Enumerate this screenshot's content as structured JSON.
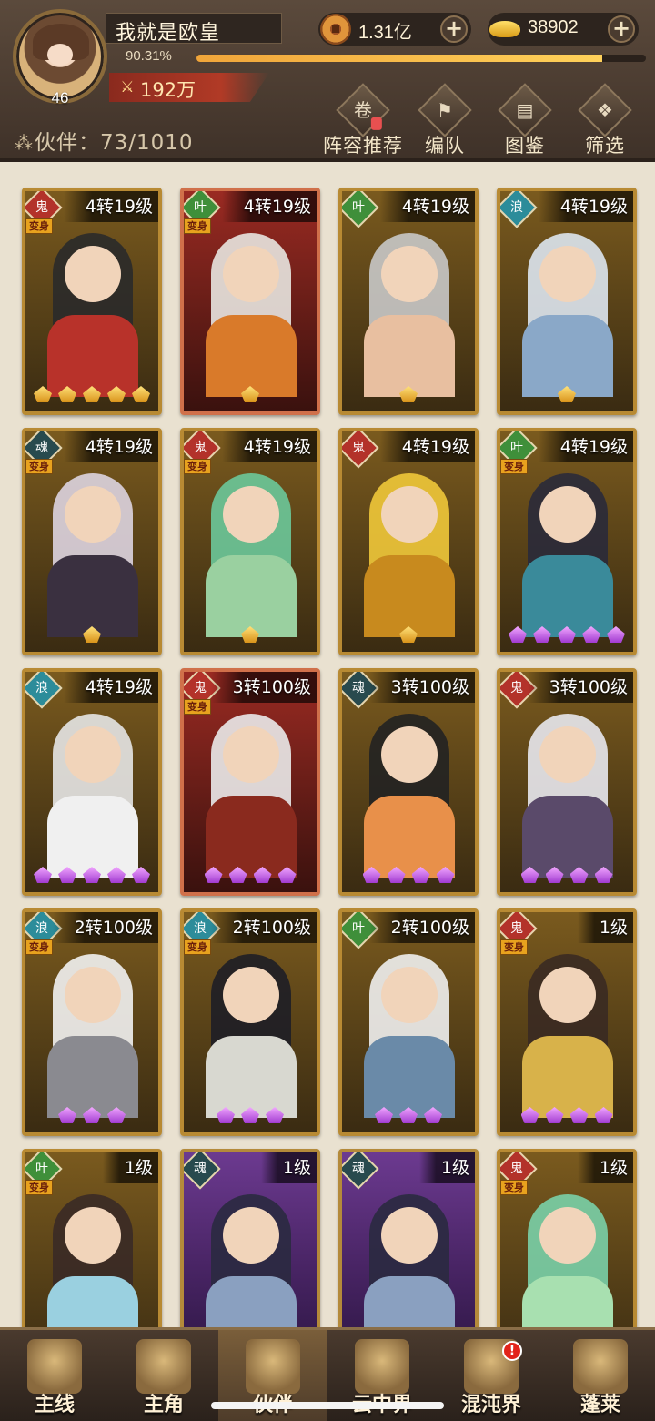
{
  "player": {
    "name": "我就是欧皇",
    "level": "46",
    "exp_percent": "90.31%",
    "exp_fraction": 0.9031,
    "power": "192万"
  },
  "resources": {
    "coins": "1.31亿",
    "gold": "38902"
  },
  "partner_count": {
    "label": "伙伴：",
    "value": "73/1010"
  },
  "menu": {
    "lineup": "阵容推荐",
    "team": "编队",
    "codex": "图鉴",
    "filter": "筛选"
  },
  "transform_label": "变身",
  "partners": [
    {
      "level": "4转19级",
      "element": "fire",
      "element_icon": "demon-mask-icon",
      "transform": true,
      "quality": "gold",
      "stars": 5,
      "star_color": "gold",
      "palette": [
        "#2a2a2a",
        "#b8322a"
      ]
    },
    {
      "level": "4转19级",
      "element": "wood",
      "element_icon": "leaf-icon",
      "transform": true,
      "quality": "red",
      "stars": 1,
      "star_color": "gold",
      "palette": [
        "#e8e6e0",
        "#d97a2a"
      ]
    },
    {
      "level": "4转19级",
      "element": "wood",
      "element_icon": "leaf-icon",
      "transform": false,
      "quality": "gold",
      "stars": 1,
      "star_color": "gold",
      "palette": [
        "#c8c8c8",
        "#e8bfa0"
      ]
    },
    {
      "level": "4转19级",
      "element": "water",
      "element_icon": "wave-icon",
      "transform": false,
      "quality": "gold",
      "stars": 1,
      "star_color": "gold",
      "palette": [
        "#dde6f0",
        "#8aa8c8"
      ]
    },
    {
      "level": "4转19级",
      "element": "dark",
      "element_icon": "ghost-icon",
      "transform": true,
      "quality": "gold",
      "stars": 1,
      "star_color": "gold",
      "palette": [
        "#ddd4e0",
        "#3a3040"
      ]
    },
    {
      "level": "4转19级",
      "element": "fire",
      "element_icon": "demon-mask-icon",
      "transform": true,
      "quality": "gold",
      "stars": 1,
      "star_color": "gold",
      "palette": [
        "#6cc89a",
        "#9ad0a0"
      ]
    },
    {
      "level": "4转19级",
      "element": "fire",
      "element_icon": "demon-mask-icon",
      "transform": false,
      "quality": "gold",
      "stars": 1,
      "star_color": "gold",
      "palette": [
        "#f0c83a",
        "#c88a1e"
      ]
    },
    {
      "level": "4转19级",
      "element": "wood",
      "element_icon": "leaf-icon",
      "transform": true,
      "quality": "gold",
      "stars": 5,
      "star_color": "purple",
      "palette": [
        "#2a2a3a",
        "#3a8a9a"
      ]
    },
    {
      "level": "4转19级",
      "element": "water",
      "element_icon": "wave-icon",
      "transform": false,
      "quality": "gold",
      "stars": 5,
      "star_color": "purple",
      "palette": [
        "#e6e6e6",
        "#f0f0f0"
      ]
    },
    {
      "level": "3转100级",
      "element": "fire",
      "element_icon": "demon-mask-icon",
      "transform": true,
      "quality": "red",
      "stars": 4,
      "star_color": "purple",
      "palette": [
        "#eaeaea",
        "#8a2a1e"
      ]
    },
    {
      "level": "3转100级",
      "element": "dark",
      "element_icon": "ghost-icon",
      "transform": false,
      "quality": "gold",
      "stars": 4,
      "star_color": "purple",
      "palette": [
        "#222222",
        "#e8904a"
      ]
    },
    {
      "level": "3转100级",
      "element": "fire",
      "element_icon": "demon-mask-icon",
      "transform": false,
      "quality": "gold",
      "stars": 4,
      "star_color": "purple",
      "palette": [
        "#e8e8ee",
        "#5a4a6a"
      ]
    },
    {
      "level": "2转100级",
      "element": "water",
      "element_icon": "wave-icon",
      "transform": true,
      "quality": "gold",
      "stars": 3,
      "star_color": "purple",
      "palette": [
        "#f2f2f2",
        "#8a8a90"
      ]
    },
    {
      "level": "2转100级",
      "element": "water",
      "element_icon": "wave-icon",
      "transform": true,
      "quality": "gold",
      "stars": 3,
      "star_color": "purple",
      "palette": [
        "#1e1e26",
        "#d8d8d0"
      ]
    },
    {
      "level": "2转100级",
      "element": "wood",
      "element_icon": "leaf-icon",
      "transform": false,
      "quality": "gold",
      "stars": 3,
      "star_color": "purple",
      "palette": [
        "#f0f0f0",
        "#6a8aa8"
      ]
    },
    {
      "level": "1级",
      "element": "fire",
      "element_icon": "demon-mask-icon",
      "transform": true,
      "quality": "gold",
      "stars": 4,
      "star_color": "purple",
      "palette": [
        "#3a2a22",
        "#d8b24a"
      ]
    },
    {
      "level": "1级",
      "element": "wood",
      "element_icon": "leaf-icon",
      "transform": true,
      "quality": "gold",
      "stars": 0,
      "star_color": "gold",
      "palette": [
        "#3a2a26",
        "#9ad0e0"
      ]
    },
    {
      "level": "1级",
      "element": "dark",
      "element_icon": "ghost-icon",
      "transform": false,
      "quality": "purple",
      "stars": 0,
      "star_color": "gold",
      "palette": [
        "#2a2a40",
        "#8aa0c0"
      ]
    },
    {
      "level": "1级",
      "element": "dark",
      "element_icon": "ghost-icon",
      "transform": false,
      "quality": "purple",
      "stars": 0,
      "star_color": "gold",
      "palette": [
        "#2a2a40",
        "#8aa0c0"
      ]
    },
    {
      "level": "1级",
      "element": "fire",
      "element_icon": "demon-mask-icon",
      "transform": true,
      "quality": "gold",
      "stars": 0,
      "star_color": "gold",
      "palette": [
        "#7ad0a8",
        "#a8e0b0"
      ]
    }
  ],
  "nav": [
    {
      "label": "主线",
      "icon": "crossed-swords-icon",
      "active": false,
      "badge": ""
    },
    {
      "label": "主角",
      "icon": "hero-helmet-icon",
      "active": false,
      "badge": ""
    },
    {
      "label": "伙伴",
      "icon": "crown-icon",
      "active": true,
      "badge": ""
    },
    {
      "label": "云中界",
      "icon": "pagoda-icon",
      "active": false,
      "badge": ""
    },
    {
      "label": "混沌界",
      "icon": "tower-icon",
      "active": false,
      "badge": "!"
    },
    {
      "label": "蓬莱",
      "icon": "sage-statue-icon",
      "active": false,
      "badge": ""
    }
  ]
}
